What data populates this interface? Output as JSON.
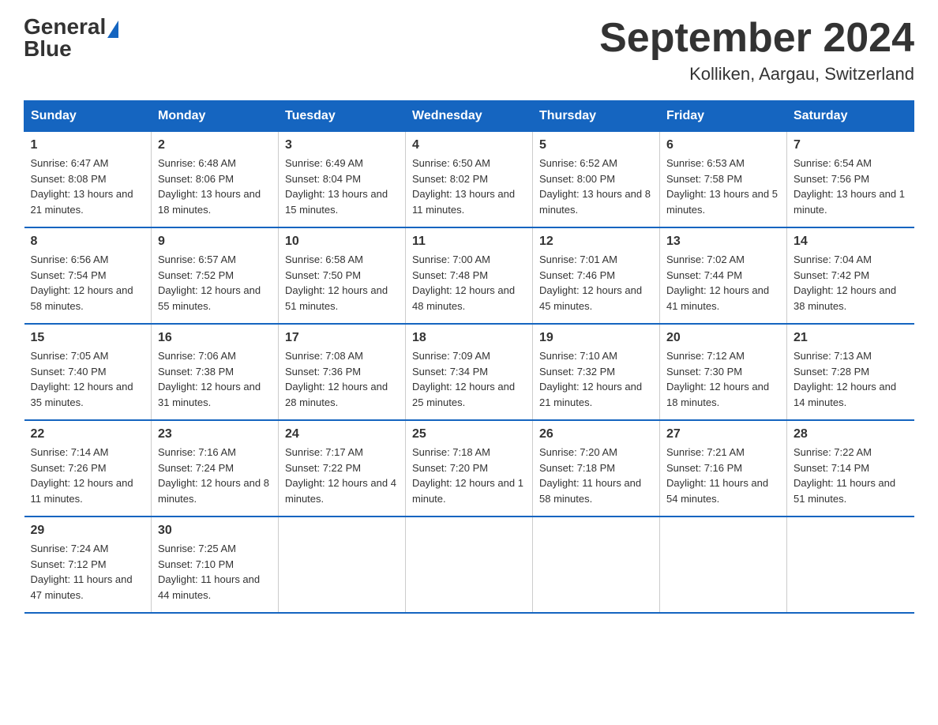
{
  "header": {
    "logo_general": "General",
    "logo_blue": "Blue",
    "title": "September 2024",
    "subtitle": "Kolliken, Aargau, Switzerland"
  },
  "days_of_week": [
    "Sunday",
    "Monday",
    "Tuesday",
    "Wednesday",
    "Thursday",
    "Friday",
    "Saturday"
  ],
  "weeks": [
    [
      {
        "day": "1",
        "sunrise": "6:47 AM",
        "sunset": "8:08 PM",
        "daylight": "13 hours and 21 minutes."
      },
      {
        "day": "2",
        "sunrise": "6:48 AM",
        "sunset": "8:06 PM",
        "daylight": "13 hours and 18 minutes."
      },
      {
        "day": "3",
        "sunrise": "6:49 AM",
        "sunset": "8:04 PM",
        "daylight": "13 hours and 15 minutes."
      },
      {
        "day": "4",
        "sunrise": "6:50 AM",
        "sunset": "8:02 PM",
        "daylight": "13 hours and 11 minutes."
      },
      {
        "day": "5",
        "sunrise": "6:52 AM",
        "sunset": "8:00 PM",
        "daylight": "13 hours and 8 minutes."
      },
      {
        "day": "6",
        "sunrise": "6:53 AM",
        "sunset": "7:58 PM",
        "daylight": "13 hours and 5 minutes."
      },
      {
        "day": "7",
        "sunrise": "6:54 AM",
        "sunset": "7:56 PM",
        "daylight": "13 hours and 1 minute."
      }
    ],
    [
      {
        "day": "8",
        "sunrise": "6:56 AM",
        "sunset": "7:54 PM",
        "daylight": "12 hours and 58 minutes."
      },
      {
        "day": "9",
        "sunrise": "6:57 AM",
        "sunset": "7:52 PM",
        "daylight": "12 hours and 55 minutes."
      },
      {
        "day": "10",
        "sunrise": "6:58 AM",
        "sunset": "7:50 PM",
        "daylight": "12 hours and 51 minutes."
      },
      {
        "day": "11",
        "sunrise": "7:00 AM",
        "sunset": "7:48 PM",
        "daylight": "12 hours and 48 minutes."
      },
      {
        "day": "12",
        "sunrise": "7:01 AM",
        "sunset": "7:46 PM",
        "daylight": "12 hours and 45 minutes."
      },
      {
        "day": "13",
        "sunrise": "7:02 AM",
        "sunset": "7:44 PM",
        "daylight": "12 hours and 41 minutes."
      },
      {
        "day": "14",
        "sunrise": "7:04 AM",
        "sunset": "7:42 PM",
        "daylight": "12 hours and 38 minutes."
      }
    ],
    [
      {
        "day": "15",
        "sunrise": "7:05 AM",
        "sunset": "7:40 PM",
        "daylight": "12 hours and 35 minutes."
      },
      {
        "day": "16",
        "sunrise": "7:06 AM",
        "sunset": "7:38 PM",
        "daylight": "12 hours and 31 minutes."
      },
      {
        "day": "17",
        "sunrise": "7:08 AM",
        "sunset": "7:36 PM",
        "daylight": "12 hours and 28 minutes."
      },
      {
        "day": "18",
        "sunrise": "7:09 AM",
        "sunset": "7:34 PM",
        "daylight": "12 hours and 25 minutes."
      },
      {
        "day": "19",
        "sunrise": "7:10 AM",
        "sunset": "7:32 PM",
        "daylight": "12 hours and 21 minutes."
      },
      {
        "day": "20",
        "sunrise": "7:12 AM",
        "sunset": "7:30 PM",
        "daylight": "12 hours and 18 minutes."
      },
      {
        "day": "21",
        "sunrise": "7:13 AM",
        "sunset": "7:28 PM",
        "daylight": "12 hours and 14 minutes."
      }
    ],
    [
      {
        "day": "22",
        "sunrise": "7:14 AM",
        "sunset": "7:26 PM",
        "daylight": "12 hours and 11 minutes."
      },
      {
        "day": "23",
        "sunrise": "7:16 AM",
        "sunset": "7:24 PM",
        "daylight": "12 hours and 8 minutes."
      },
      {
        "day": "24",
        "sunrise": "7:17 AM",
        "sunset": "7:22 PM",
        "daylight": "12 hours and 4 minutes."
      },
      {
        "day": "25",
        "sunrise": "7:18 AM",
        "sunset": "7:20 PM",
        "daylight": "12 hours and 1 minute."
      },
      {
        "day": "26",
        "sunrise": "7:20 AM",
        "sunset": "7:18 PM",
        "daylight": "11 hours and 58 minutes."
      },
      {
        "day": "27",
        "sunrise": "7:21 AM",
        "sunset": "7:16 PM",
        "daylight": "11 hours and 54 minutes."
      },
      {
        "day": "28",
        "sunrise": "7:22 AM",
        "sunset": "7:14 PM",
        "daylight": "11 hours and 51 minutes."
      }
    ],
    [
      {
        "day": "29",
        "sunrise": "7:24 AM",
        "sunset": "7:12 PM",
        "daylight": "11 hours and 47 minutes."
      },
      {
        "day": "30",
        "sunrise": "7:25 AM",
        "sunset": "7:10 PM",
        "daylight": "11 hours and 44 minutes."
      },
      null,
      null,
      null,
      null,
      null
    ]
  ]
}
